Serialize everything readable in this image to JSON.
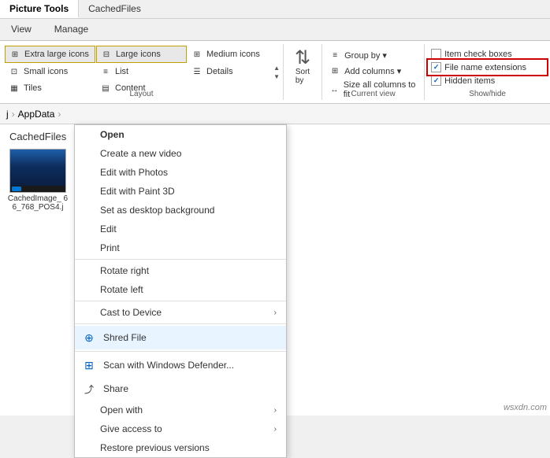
{
  "titlebar": {
    "picture_tools": "Picture Tools",
    "cached_files": "CachedFiles"
  },
  "ribbon": {
    "tabs": [
      "View",
      "Manage"
    ],
    "layout_group_label": "Layout",
    "current_view_group_label": "Current view",
    "showhide_group_label": "Show/hide",
    "layout_items": [
      {
        "label": "Extra large icons",
        "active": false
      },
      {
        "label": "Large icons",
        "active": true
      },
      {
        "label": "Medium icons",
        "active": false
      },
      {
        "label": "Small icons",
        "active": false
      },
      {
        "label": "List",
        "active": false
      },
      {
        "label": "Details",
        "active": false
      },
      {
        "label": "Tiles",
        "active": false
      },
      {
        "label": "Content",
        "active": false
      }
    ],
    "current_view_items": [
      {
        "label": "Group by ▾",
        "icon": "≡"
      },
      {
        "label": "Add columns ▾",
        "icon": "⊞"
      },
      {
        "label": "Size all columns to fit",
        "icon": "↔"
      }
    ],
    "showhide_items": [
      {
        "label": "Item check boxes",
        "checked": false
      },
      {
        "label": "File name extensions",
        "checked": true
      },
      {
        "label": "Hidden items",
        "checked": true
      }
    ],
    "sort_label": "Sort\nby"
  },
  "breadcrumb": {
    "path_parts": [
      "j",
      "AppData"
    ]
  },
  "folder": {
    "title": "CachedFiles"
  },
  "file": {
    "name": "CachedImage_\n66_768_POS4.j"
  },
  "context_menu": {
    "items": [
      {
        "label": "Open",
        "bold": true,
        "has_icon": false,
        "has_arrow": false,
        "separator_after": false
      },
      {
        "label": "Create a new video",
        "bold": false,
        "has_icon": false,
        "has_arrow": false,
        "separator_after": false
      },
      {
        "label": "Edit with Photos",
        "bold": false,
        "has_icon": false,
        "has_arrow": false,
        "separator_after": false
      },
      {
        "label": "Edit with Paint 3D",
        "bold": false,
        "has_icon": false,
        "has_arrow": false,
        "separator_after": false
      },
      {
        "label": "Set as desktop background",
        "bold": false,
        "has_icon": false,
        "has_arrow": false,
        "separator_after": false
      },
      {
        "label": "Edit",
        "bold": false,
        "has_icon": false,
        "has_arrow": false,
        "separator_after": false
      },
      {
        "label": "Print",
        "bold": false,
        "has_icon": false,
        "has_arrow": false,
        "separator_after": true
      },
      {
        "label": "Rotate right",
        "bold": false,
        "has_icon": false,
        "has_arrow": false,
        "separator_after": false
      },
      {
        "label": "Rotate left",
        "bold": false,
        "has_icon": false,
        "has_arrow": false,
        "separator_after": true
      },
      {
        "label": "Cast to Device",
        "bold": false,
        "has_icon": false,
        "has_arrow": true,
        "separator_after": false
      },
      {
        "label": "Shred File",
        "bold": false,
        "has_icon": true,
        "icon_type": "shred",
        "has_arrow": false,
        "separator_after": true
      },
      {
        "label": "Scan with Windows Defender...",
        "bold": false,
        "has_icon": true,
        "icon_type": "defender",
        "has_arrow": false,
        "separator_after": false
      },
      {
        "label": "Share",
        "bold": false,
        "has_icon": true,
        "icon_type": "share",
        "has_arrow": false,
        "separator_after": false
      },
      {
        "label": "Open with",
        "bold": false,
        "has_icon": false,
        "has_arrow": true,
        "separator_after": false
      },
      {
        "label": "Give access to",
        "bold": false,
        "has_icon": false,
        "has_arrow": true,
        "separator_after": false
      },
      {
        "label": "Restore previous versions",
        "bold": false,
        "has_icon": false,
        "has_arrow": false,
        "separator_after": false
      }
    ]
  },
  "watermark": "wsxdn.com"
}
